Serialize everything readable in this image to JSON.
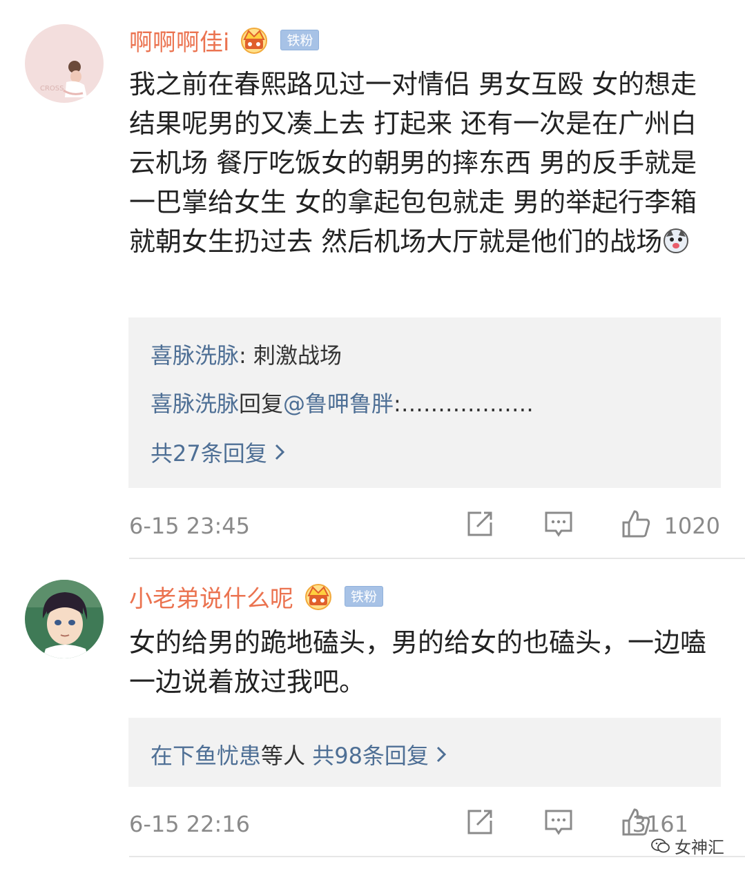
{
  "comments": [
    {
      "username": "啊啊啊佳i",
      "badge": "铁粉",
      "text": "我之前在春熙路见过一对情侣 男女互殴 女的想走 结果呢男的又凑上去 打起来   还有一次是在广州白云机场 餐厅吃饭女的朝男的摔东西 男的反手就是一巴掌给女生 女的拿起包包就走 男的举起行李箱就朝女生扔过去 然后机场大厅就是他们的战场",
      "replies": [
        {
          "who": "喜脉洗脉",
          "sep": ": ",
          "content": "刺激战场"
        },
        {
          "who": "喜脉洗脉",
          "sep": "回复",
          "mention": "@鲁呷鲁胖",
          "content": ":………………"
        }
      ],
      "more_replies": "共27条回复",
      "time": "6-15 23:45",
      "likes": "1020"
    },
    {
      "username": "小老弟说什么呢",
      "badge": "铁粉",
      "text": "女的给男的跪地磕头，男的给女的也磕头，一边嗑一边说着放过我吧。",
      "reply_summary": {
        "who": "在下鱼忧患",
        "suffix": "等人 ",
        "more": "共98条回复"
      },
      "time": "6-15 22:16",
      "likes": "3161"
    }
  ],
  "watermark": "女神汇",
  "icons": [
    "crown-icon",
    "repost-icon",
    "comment-icon",
    "like-icon",
    "chevron-right-icon",
    "husky-emoji-icon",
    "wechat-icon"
  ],
  "colors": {
    "username": "#eb7350",
    "link": "#4e6f95",
    "meta": "#8a8a8a",
    "reply_bg": "#f2f2f2",
    "badge": "#a7c2e6"
  }
}
